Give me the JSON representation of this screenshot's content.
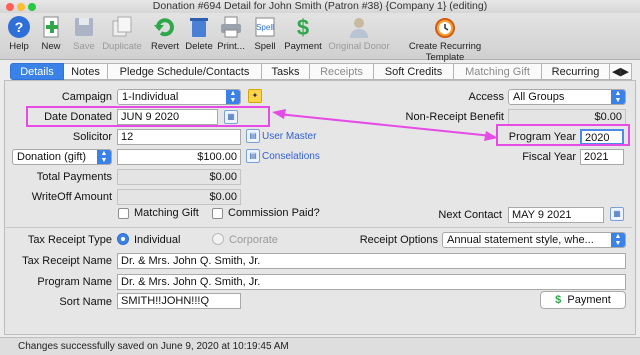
{
  "window": {
    "title": "Donation #694 Detail for John Smith (Patron #38) {Company 1} (editing)"
  },
  "toolbar": {
    "items": [
      {
        "label": "Help",
        "icon": "help-icon"
      },
      {
        "label": "New",
        "icon": "new-icon"
      },
      {
        "label": "Save",
        "icon": "save-icon"
      },
      {
        "label": "Duplicate",
        "icon": "duplicate-icon"
      },
      {
        "label": "Revert",
        "icon": "revert-icon"
      },
      {
        "label": "Delete",
        "icon": "delete-icon"
      },
      {
        "label": "Print...",
        "icon": "print-icon"
      },
      {
        "label": "Spell",
        "icon": "spell-icon"
      },
      {
        "label": "Payment",
        "icon": "payment-icon"
      },
      {
        "label": "Original Donor",
        "icon": "original-donor-icon"
      },
      {
        "label": "Create Recurring Template",
        "icon": "alarm-clock-icon"
      }
    ]
  },
  "tabs": [
    "Details",
    "Notes",
    "Pledge Schedule/Contacts",
    "Tasks",
    "Receipts",
    "Soft Credits",
    "Matching Gift",
    "Recurring"
  ],
  "form": {
    "campaign_label": "Campaign",
    "campaign_value": "1-Individual",
    "date_donated_label": "Date Donated",
    "date_donated_value": "JUN 9 2020",
    "solicitor_label": "Solicitor",
    "solicitor_value": "12",
    "user_master_link": "User Master",
    "type_value": "Donation (gift)",
    "amount_value": "$100.00",
    "conselations_link": "Conselations",
    "total_payments_label": "Total Payments",
    "total_payments_value": "$0.00",
    "writeoff_label": "WriteOff Amount",
    "writeoff_value": "$0.00",
    "matching_gift_label": "Matching Gift",
    "commission_label": "Commission Paid?",
    "access_label": "Access",
    "access_value": "All Groups",
    "non_receipt_label": "Non-Receipt Benefit",
    "non_receipt_value": "$0.00",
    "program_year_label": "Program Year",
    "program_year_value": "2020",
    "fiscal_year_label": "Fiscal Year",
    "fiscal_year_value": "2021",
    "next_contact_label": "Next Contact",
    "next_contact_value": "MAY 9 2021",
    "tax_receipt_type_label": "Tax Receipt Type",
    "individual_label": "Individual",
    "corporate_label": "Corporate",
    "receipt_options_label": "Receipt Options",
    "receipt_options_value": "Annual statement style, whe...",
    "tax_receipt_name_label": "Tax Receipt Name",
    "tax_receipt_name_value": "Dr. & Mrs. John Q. Smith, Jr.",
    "program_name_label": "Program Name",
    "program_name_value": "Dr. & Mrs. John Q. Smith, Jr.",
    "sort_name_label": "Sort Name",
    "sort_name_value": "SMITH!!JOHN!!!Q",
    "payment_button": "Payment"
  },
  "status": {
    "message": "Changes successfully saved on June 9, 2020 at 10:19:45 AM"
  },
  "colors": {
    "accent": "#3b82e8",
    "highlight": "#e54be5"
  }
}
